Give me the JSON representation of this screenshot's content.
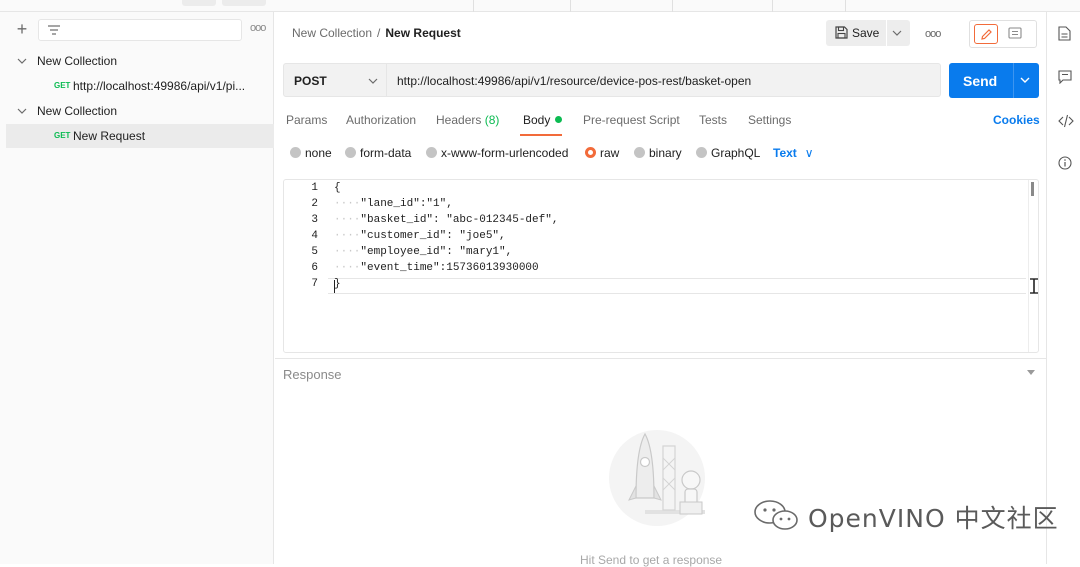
{
  "sidebar": {
    "items": [
      {
        "type": "collection",
        "label": "New Collection"
      },
      {
        "type": "request",
        "method": "GET",
        "label": "http://localhost:49986/api/v1/pi..."
      },
      {
        "type": "collection",
        "label": "New Collection"
      },
      {
        "type": "request",
        "method": "GET",
        "label": "New Request",
        "selected": true
      }
    ]
  },
  "header": {
    "breadcrumb": [
      "New Collection",
      "New Request"
    ],
    "save_label": "Save"
  },
  "request": {
    "method": "POST",
    "url": "http://localhost:49986/api/v1/resource/device-pos-rest/basket-open",
    "send_label": "Send"
  },
  "tabs": [
    {
      "label": "Params"
    },
    {
      "label": "Authorization"
    },
    {
      "label": "Headers",
      "count": "(8)"
    },
    {
      "label": "Body",
      "active": true
    },
    {
      "label": "Pre-request Script"
    },
    {
      "label": "Tests"
    },
    {
      "label": "Settings"
    }
  ],
  "cookies_label": "Cookies",
  "body_options": [
    {
      "label": "none"
    },
    {
      "label": "form-data"
    },
    {
      "label": "x-www-form-urlencoded"
    },
    {
      "label": "raw",
      "selected": true
    },
    {
      "label": "binary"
    },
    {
      "label": "GraphQL"
    }
  ],
  "body_type": "Text",
  "editor": {
    "lines": [
      {
        "n": "1",
        "indent": "",
        "text": "{"
      },
      {
        "n": "2",
        "indent": "····",
        "text": "\"lane_id\":\"1\","
      },
      {
        "n": "3",
        "indent": "····",
        "text": "\"basket_id\": \"abc-012345-def\","
      },
      {
        "n": "4",
        "indent": "····",
        "text": "\"customer_id\": \"joe5\","
      },
      {
        "n": "5",
        "indent": "····",
        "text": "\"employee_id\": \"mary1\","
      },
      {
        "n": "6",
        "indent": "····",
        "text": "\"event_time\":15736013930000"
      },
      {
        "n": "7",
        "indent": "",
        "text": "}"
      }
    ]
  },
  "response": {
    "label": "Response",
    "hint": "Hit Send to get a response"
  },
  "watermark": "OpenVINO 中文社区",
  "colors": {
    "accent": "#f26b3a",
    "send": "#097bed",
    "success": "#0cbb52"
  }
}
